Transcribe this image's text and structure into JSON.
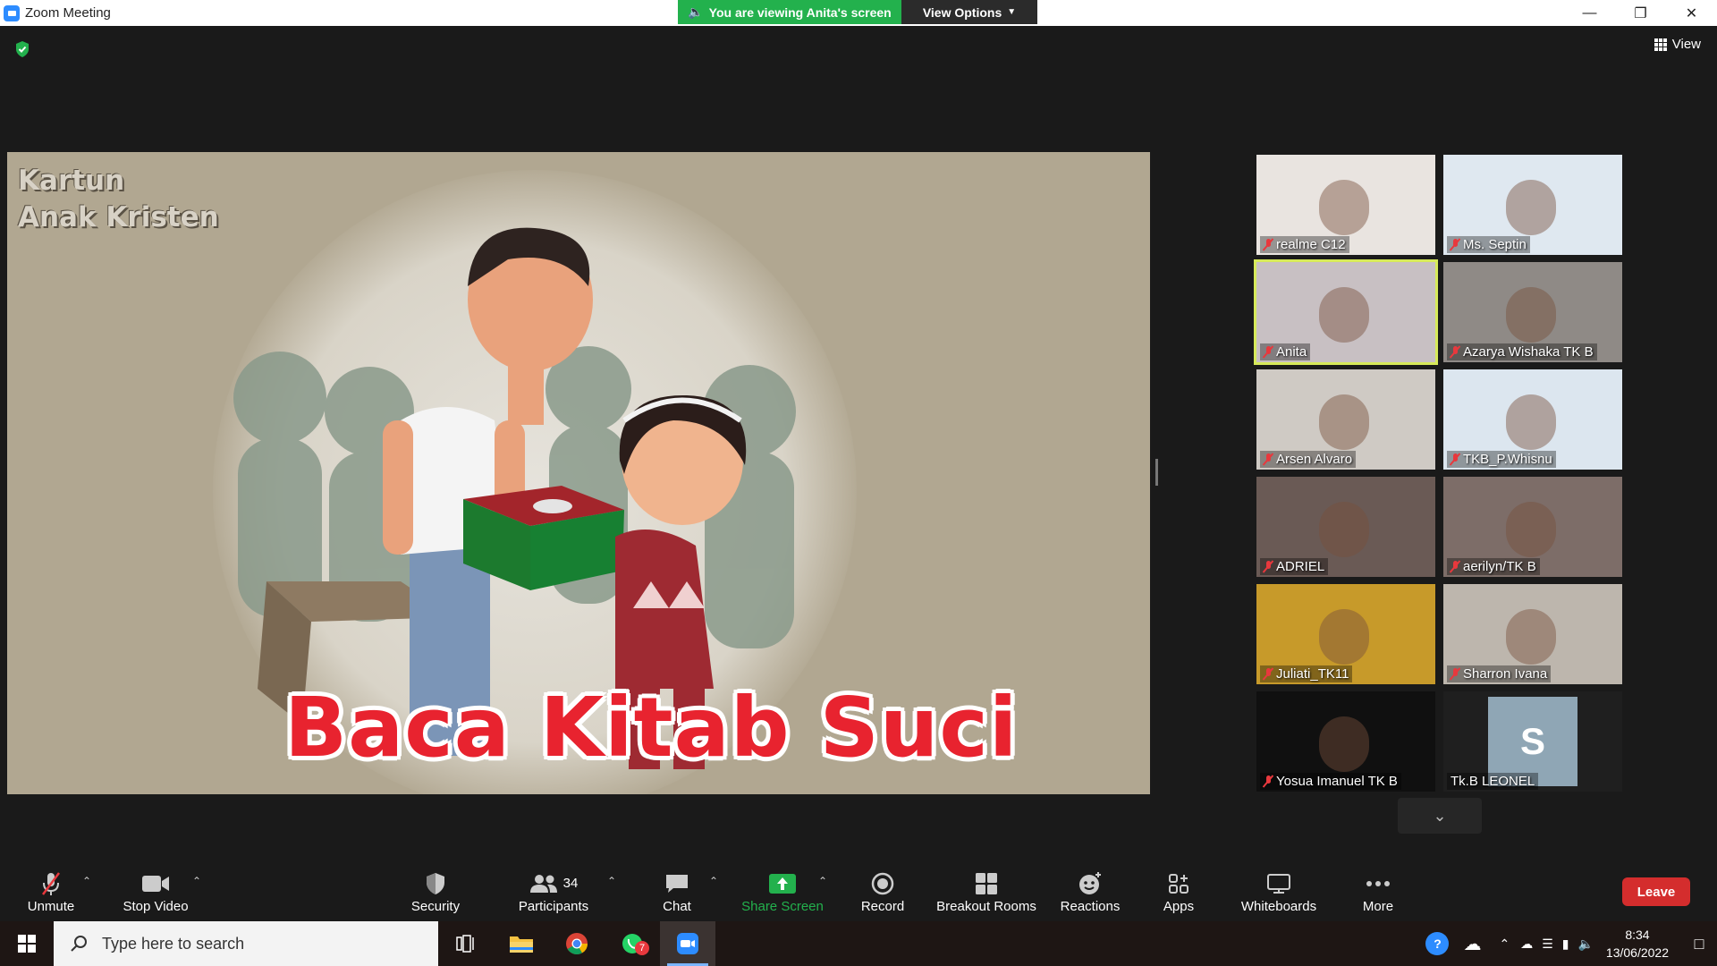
{
  "window": {
    "title": "Zoom Meeting",
    "viewing_banner": "You are viewing Anita's screen",
    "view_options": "View Options",
    "view_button": "View"
  },
  "shared_screen": {
    "caption_line1": "Kartun",
    "caption_line2": "Anak Kristen",
    "title": "Baca Kitab Suci"
  },
  "participants": [
    {
      "name": "realme C12",
      "bg": "#e9e4e0"
    },
    {
      "name": "Ms. Septin",
      "bg": "#dfe8f0"
    },
    {
      "name": "Anita",
      "bg": "#c8c0c3",
      "active": true
    },
    {
      "name": "Azarya Wishaka  TK B",
      "bg": "#8f8a86"
    },
    {
      "name": "Arsen Alvaro",
      "bg": "#cfcac4"
    },
    {
      "name": "TKB_P.Whisnu",
      "bg": "#dce6ef"
    },
    {
      "name": "ADRIEL",
      "bg": "#6a5a55"
    },
    {
      "name": "aerilyn/TK B",
      "bg": "#7d6d68"
    },
    {
      "name": "Juliati_TK11",
      "bg": "#c79a2a"
    },
    {
      "name": "Sharron Ivana",
      "bg": "#bdb6ad"
    },
    {
      "name": "Yosua Imanuel TK B",
      "bg": "#101010"
    },
    {
      "name": "Tk.B LEONEL",
      "bg": "#1f1f1f",
      "avatar_letter": "S"
    }
  ],
  "toolbar": {
    "unmute": "Unmute",
    "stop_video": "Stop Video",
    "security": "Security",
    "participants": "Participants",
    "participants_count": "34",
    "chat": "Chat",
    "share_screen": "Share Screen",
    "record": "Record",
    "breakout_rooms": "Breakout Rooms",
    "reactions": "Reactions",
    "apps": "Apps",
    "whiteboards": "Whiteboards",
    "more": "More",
    "leave": "Leave"
  },
  "taskbar": {
    "search_placeholder": "Type here to search",
    "whatsapp_badge": "7",
    "time": "8:34",
    "date": "13/06/2022"
  },
  "colors": {
    "accent_green": "#23b14d",
    "leave_red": "#d42d2d",
    "active_speaker": "#d7ea5a"
  }
}
